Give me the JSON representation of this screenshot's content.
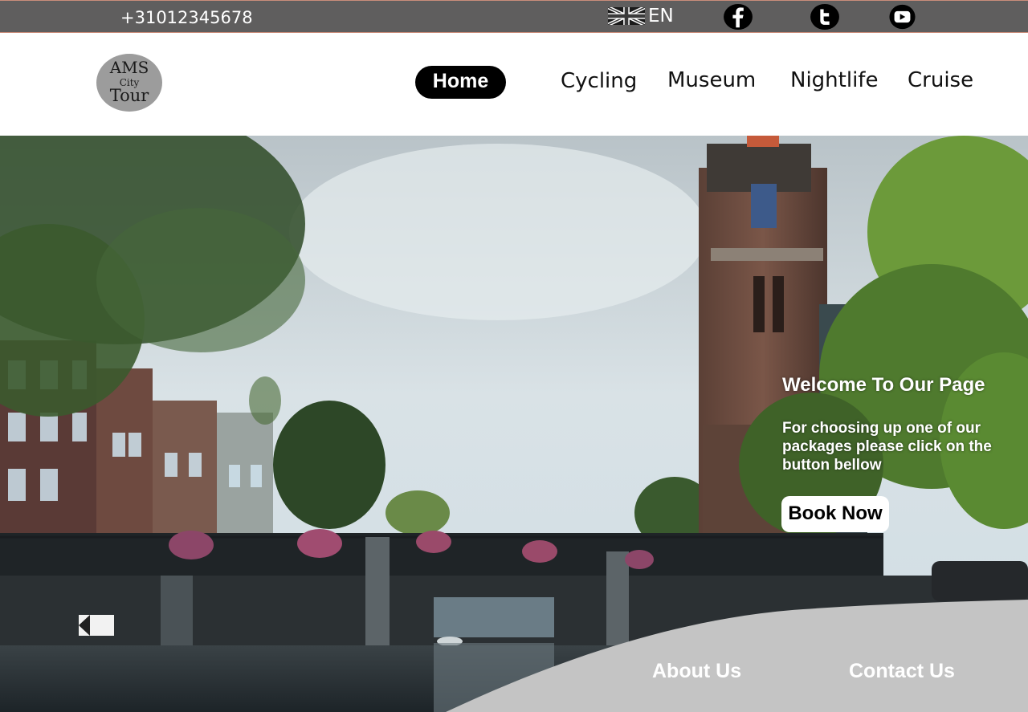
{
  "topbar": {
    "phone": "+31012345678",
    "language": "EN",
    "language_flag": "uk-flag-icon",
    "social": [
      "facebook-icon",
      "twitter-icon",
      "youtube-icon"
    ],
    "colors": {
      "background": "#5f5e5e",
      "border": "#c98d7a"
    }
  },
  "header": {
    "logo": {
      "line1": "AMS",
      "line2": "City",
      "line3": "Tour"
    },
    "nav": {
      "home": "Home",
      "cycling": "Cycling",
      "museum": "Museum",
      "nightlife": "Nightlife",
      "cruise": "Cruise"
    },
    "active_item": "home"
  },
  "hero": {
    "title": "Welcome To Our Page",
    "text": "For choosing up one  of our packages please click on the button bellow",
    "cta_label": "Book Now"
  },
  "footer": {
    "about_label": "About Us",
    "contact_label": "Contact Us",
    "wave_color": "#c4c4c4"
  }
}
